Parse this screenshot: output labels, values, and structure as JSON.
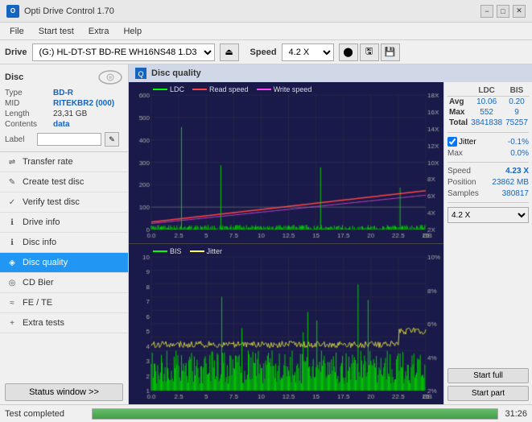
{
  "titlebar": {
    "title": "Opti Drive Control 1.70",
    "min_label": "−",
    "max_label": "□",
    "close_label": "✕"
  },
  "menubar": {
    "items": [
      "File",
      "Start test",
      "Extra",
      "Help"
    ]
  },
  "drivebar": {
    "label": "Drive",
    "drive_value": "(G:) HL-DT-ST BD-RE  WH16NS48 1.D3",
    "speed_label": "Speed",
    "speed_value": "4.2 X"
  },
  "disc": {
    "type_label": "Type",
    "type_value": "BD-R",
    "mid_label": "MID",
    "mid_value": "RITEKBR2 (000)",
    "length_label": "Length",
    "length_value": "23,31 GB",
    "contents_label": "Contents",
    "contents_value": "data",
    "label_label": "Label",
    "label_value": ""
  },
  "nav": {
    "items": [
      {
        "id": "transfer-rate",
        "label": "Transfer rate"
      },
      {
        "id": "create-test-disc",
        "label": "Create test disc"
      },
      {
        "id": "verify-test-disc",
        "label": "Verify test disc"
      },
      {
        "id": "drive-info",
        "label": "Drive info"
      },
      {
        "id": "disc-info",
        "label": "Disc info"
      },
      {
        "id": "disc-quality",
        "label": "Disc quality",
        "active": true
      },
      {
        "id": "cd-bier",
        "label": "CD Bier"
      },
      {
        "id": "fe-te",
        "label": "FE / TE"
      },
      {
        "id": "extra-tests",
        "label": "Extra tests"
      }
    ],
    "status_window": "Status window >>"
  },
  "disc_quality": {
    "title": "Disc quality",
    "legend": [
      {
        "label": "LDC",
        "color": "#00ff00"
      },
      {
        "label": "Read speed",
        "color": "#ff0000"
      },
      {
        "label": "Write speed",
        "color": "#ff00ff"
      }
    ],
    "legend_bottom": [
      {
        "label": "BIS",
        "color": "#00ff00"
      },
      {
        "label": "Jitter",
        "color": "#ffff00"
      }
    ],
    "top_y_max": 600,
    "top_y_right_labels": [
      "18X",
      "16X",
      "14X",
      "12X",
      "10X",
      "8X",
      "6X",
      "4X",
      "2X"
    ],
    "bottom_y_max": 10,
    "bottom_y_right_labels": [
      "10%",
      "8%",
      "6%",
      "4%",
      "2%"
    ],
    "x_max": 25
  },
  "stats": {
    "headers": [
      "LDC",
      "BIS",
      "",
      "Jitter",
      "Speed"
    ],
    "avg_label": "Avg",
    "avg_ldc": "10.06",
    "avg_bis": "0.20",
    "avg_jitter": "-0.1%",
    "max_label": "Max",
    "max_ldc": "552",
    "max_bis": "9",
    "max_jitter": "0.0%",
    "total_label": "Total",
    "total_ldc": "3841838",
    "total_bis": "75257",
    "speed_label": "Speed",
    "speed_value": "4.23 X",
    "position_label": "Position",
    "position_value": "23862 MB",
    "samples_label": "Samples",
    "samples_value": "380817",
    "jitter_checked": true,
    "jitter_label": "Jitter",
    "speed_select_value": "4.2 X",
    "start_full_label": "Start full",
    "start_part_label": "Start part"
  },
  "statusbar": {
    "text": "Test completed",
    "progress": 100,
    "time": "31:26"
  }
}
